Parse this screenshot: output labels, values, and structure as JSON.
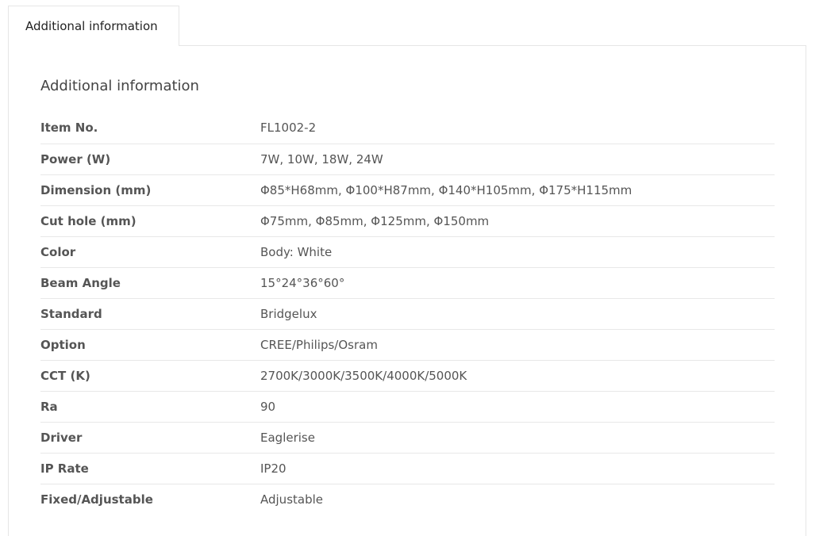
{
  "tabs": [
    {
      "label": "Additional information",
      "active": true
    }
  ],
  "panel": {
    "title": "Additional information",
    "rows": [
      {
        "label": "Item No.",
        "value": "FL1002-2"
      },
      {
        "label": "Power (W)",
        "value": "7W, 10W, 18W, 24W"
      },
      {
        "label": "Dimension (mm)",
        "value": "Φ85*H68mm, Φ100*H87mm, Φ140*H105mm, Φ175*H115mm"
      },
      {
        "label": "Cut hole (mm)",
        "value": "Φ75mm, Φ85mm, Φ125mm, Φ150mm"
      },
      {
        "label": "Color",
        "value": "Body: White"
      },
      {
        "label": "Beam Angle",
        "value": "15°24°36°60°"
      },
      {
        "label": "Standard",
        "value": "Bridgelux"
      },
      {
        "label": "Option",
        "value": "CREE/Philips/Osram"
      },
      {
        "label": "CCT (K)",
        "value": "2700K/3000K/3500K/4000K/5000K"
      },
      {
        "label": "Ra",
        "value": "90"
      },
      {
        "label": "Driver",
        "value": "Eaglerise"
      },
      {
        "label": "IP Rate",
        "value": "IP20"
      },
      {
        "label": "Fixed/Adjustable",
        "value": "Adjustable"
      }
    ]
  }
}
